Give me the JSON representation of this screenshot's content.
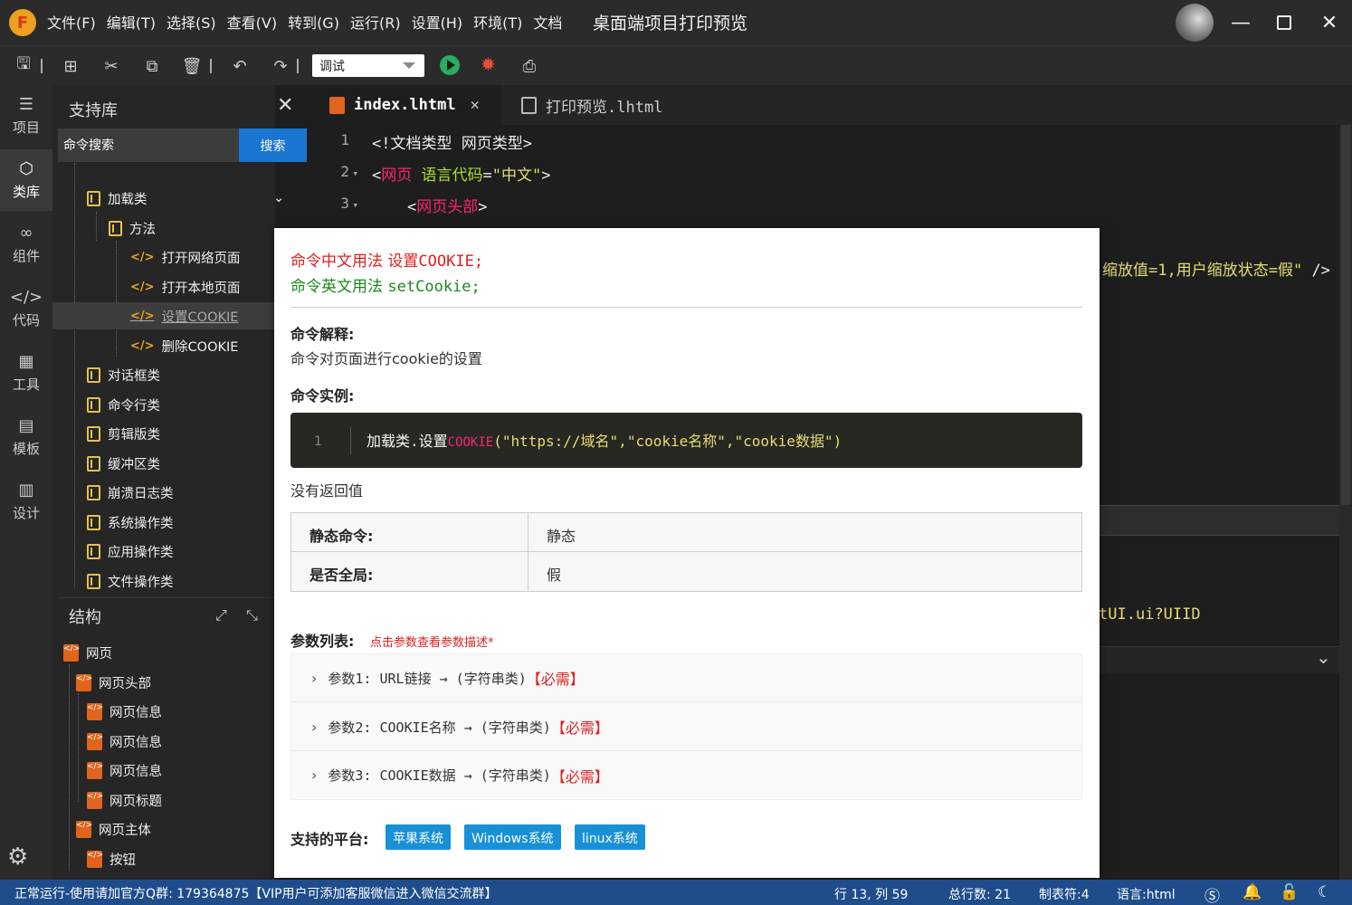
{
  "titlebar": {
    "logo": "F",
    "menu": [
      "文件(F)",
      "编辑(T)",
      "选择(S)",
      "查看(V)",
      "转到(G)",
      "运行(R)",
      "设置(H)",
      "环境(T)",
      "文档"
    ],
    "title": "桌面端项目打印预览"
  },
  "toolbar": {
    "mode": "调试",
    "icons": [
      "save-icon",
      "new-file-icon",
      "cut-icon",
      "copy-icon",
      "delete-icon",
      "undo-icon",
      "redo-icon",
      "run-icon",
      "debug-icon",
      "print-preview-icon"
    ]
  },
  "activity": [
    {
      "label": "项目",
      "icon": "layers-icon"
    },
    {
      "label": "类库",
      "icon": "cube-icon"
    },
    {
      "label": "组件",
      "icon": "link-icon"
    },
    {
      "label": "代码",
      "icon": "code-icon"
    },
    {
      "label": "工具",
      "icon": "tools-icon"
    },
    {
      "label": "模板",
      "icon": "template-icon"
    },
    {
      "label": "设计",
      "icon": "design-icon"
    }
  ],
  "library": {
    "title": "支持库",
    "search_placeholder": "命令搜索",
    "search_button": "搜索",
    "items": [
      {
        "label": "加载类",
        "type": "folder",
        "indent": 1
      },
      {
        "label": "方法",
        "type": "folder",
        "indent": 2
      },
      {
        "label": "打开网络页面",
        "type": "code",
        "indent": 3
      },
      {
        "label": "打开本地页面",
        "type": "code",
        "indent": 3
      },
      {
        "label": "设置COOKIE",
        "type": "code",
        "indent": 3,
        "selected": true
      },
      {
        "label": "删除COOKIE",
        "type": "code",
        "indent": 3
      },
      {
        "label": "对话框类",
        "type": "folder",
        "indent": 1
      },
      {
        "label": "命令行类",
        "type": "folder",
        "indent": 1
      },
      {
        "label": "剪辑版类",
        "type": "folder",
        "indent": 1
      },
      {
        "label": "缓冲区类",
        "type": "folder",
        "indent": 1
      },
      {
        "label": "崩溃日志类",
        "type": "folder",
        "indent": 1
      },
      {
        "label": "系统操作类",
        "type": "folder",
        "indent": 1
      },
      {
        "label": "应用操作类",
        "type": "folder",
        "indent": 1
      },
      {
        "label": "文件操作类",
        "type": "folder",
        "indent": 1
      }
    ]
  },
  "structure": {
    "title": "结构",
    "items": [
      {
        "label": "网页",
        "indent": 0
      },
      {
        "label": "网页头部",
        "indent": 1
      },
      {
        "label": "网页信息",
        "indent": 2
      },
      {
        "label": "网页信息",
        "indent": 2
      },
      {
        "label": "网页信息",
        "indent": 2
      },
      {
        "label": "网页标题",
        "indent": 2
      },
      {
        "label": "网页主体",
        "indent": 1
      },
      {
        "label": "按钮",
        "indent": 2
      }
    ]
  },
  "editor": {
    "tabs": [
      {
        "label": "index.lhtml",
        "active": true
      },
      {
        "label": "打印预览.lhtml",
        "active": false
      }
    ],
    "lines": [
      {
        "n": "1",
        "fold": ""
      },
      {
        "n": "2",
        "fold": "▾"
      },
      {
        "n": "3",
        "fold": "▾"
      }
    ],
    "line1": "<!文档类型 网页类型>",
    "line2_tag": "网页",
    "line2_attr": "语言代码",
    "line2_val": "\"中文\"",
    "line3_tag": "网页头部",
    "frag1": "缩放值=1,用户缩放状态=假\"",
    "frag1_end": "/>",
    "frag2": "tUI.ui?UIID"
  },
  "popup": {
    "cn_usage_label": "命令中文用法",
    "cn_usage": "设置COOKIE;",
    "en_usage_label": "命令英文用法",
    "en_usage": "setCookie;",
    "explain_title": "命令解释:",
    "explain_text": "命令对页面进行cookie的设置",
    "example_title": "命令实例:",
    "example_line_no": "1",
    "example_prefix": "加载类.设置",
    "example_kw": "COOKIE",
    "example_args": "(\"https://域名\",\"cookie名称\",\"cookie数据\")",
    "return_text": "没有返回值",
    "props": [
      {
        "key": "静态命令:",
        "value": "静态"
      },
      {
        "key": "是否全局:",
        "value": "假"
      }
    ],
    "params_title": "参数列表:",
    "params_hint": "点击参数查看参数描述*",
    "params": [
      {
        "text": "参数1: URL链接 → (字符串类)",
        "req": "【必需】"
      },
      {
        "text": "参数2: COOKIE名称 → (字符串类)",
        "req": "【必需】"
      },
      {
        "text": "参数3: COOKIE数据 → (字符串类)",
        "req": "【必需】"
      }
    ],
    "platforms_title": "支持的平台:",
    "platforms": [
      "苹果系统",
      "Windows系统",
      "linux系统"
    ]
  },
  "statusbar": {
    "left": "正常运行-使用请加官方Q群: 179364875【VIP用户可添加客服微信进入微信交流群】",
    "position": "行 13, 列 59",
    "total": "总行数: 21",
    "tab": "制表符:4",
    "lang": "语言:html"
  }
}
